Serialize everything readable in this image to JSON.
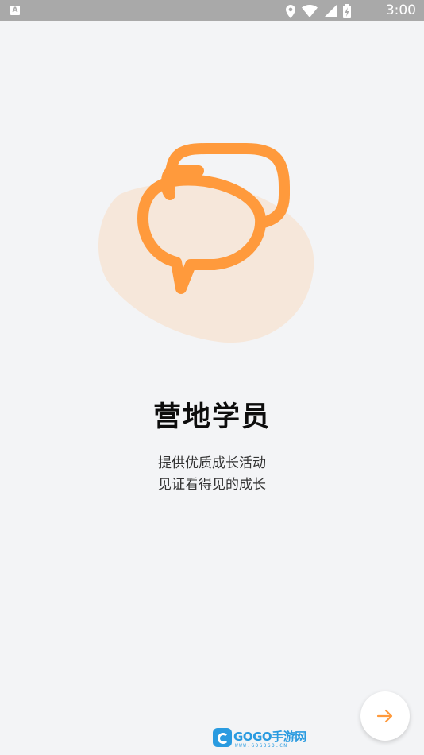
{
  "status_bar": {
    "left_icon": "A",
    "icons": [
      "location-icon",
      "wifi-icon",
      "cellular-signal-icon",
      "battery-charging-icon"
    ],
    "time": "3:00"
  },
  "illustration": {
    "icon": "chat-bubbles-icon",
    "blob_color": "#f6e7da",
    "accent_color": "#ff9a3c"
  },
  "content": {
    "title": "营地学员",
    "subtitle_line1": "提供优质成长活动",
    "subtitle_line2": "见证看得见的成长"
  },
  "next_button": {
    "icon": "arrow-right-icon",
    "color": "#ff9a3c"
  },
  "watermark": {
    "text": "GOGO手游网",
    "url": "WWW.GOGOGO.CN",
    "color": "#2a9be0"
  }
}
